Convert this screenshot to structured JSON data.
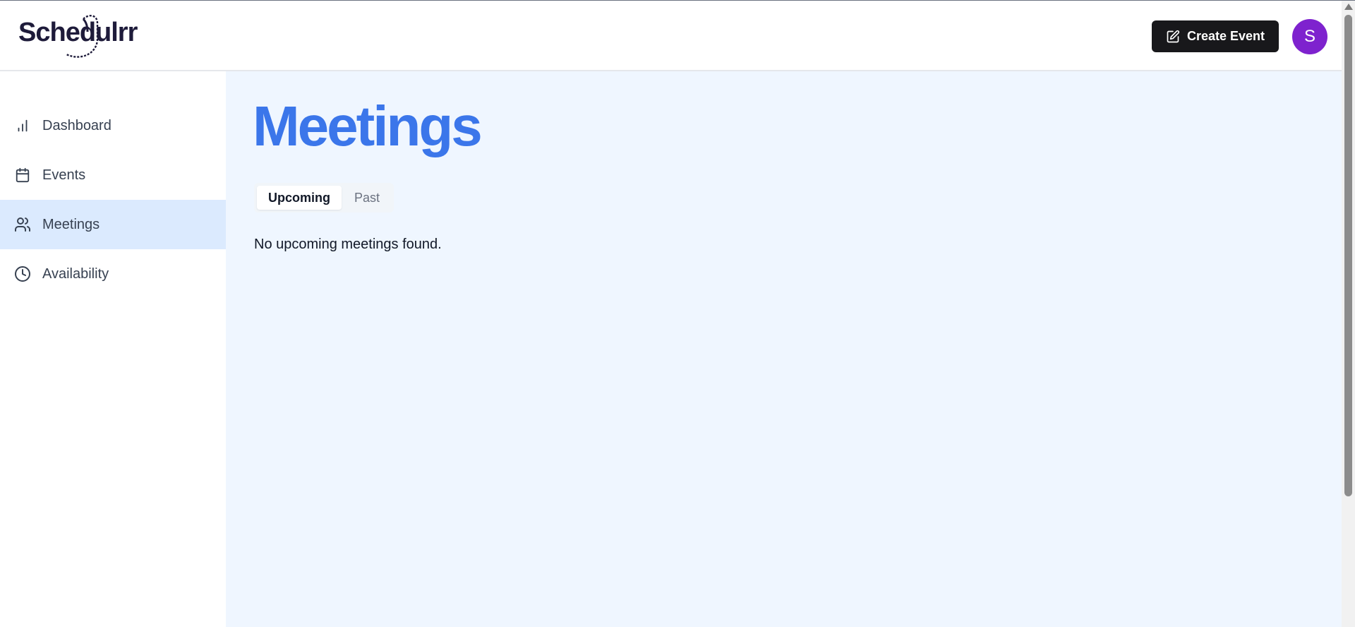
{
  "app": {
    "logo_text": "Schedulrr"
  },
  "header": {
    "create_button_label": "Create Event",
    "create_button_icon": "pen-square-icon",
    "avatar_initial": "S"
  },
  "sidebar": {
    "items": [
      {
        "label": "Dashboard",
        "icon": "bar-chart-icon",
        "active": false
      },
      {
        "label": "Events",
        "icon": "calendar-icon",
        "active": false
      },
      {
        "label": "Meetings",
        "icon": "users-icon",
        "active": true
      },
      {
        "label": "Availability",
        "icon": "clock-icon",
        "active": false
      }
    ]
  },
  "main": {
    "title": "Meetings",
    "tabs": [
      {
        "label": "Upcoming",
        "active": true
      },
      {
        "label": "Past",
        "active": false
      }
    ],
    "empty_message": "No upcoming meetings found."
  },
  "colors": {
    "accent_title": "#3b76ea",
    "sidebar_active_bg": "#dbeafe",
    "main_bg": "#eff6ff",
    "button_bg": "#18181b",
    "avatar_bg": "#7e22ce"
  }
}
